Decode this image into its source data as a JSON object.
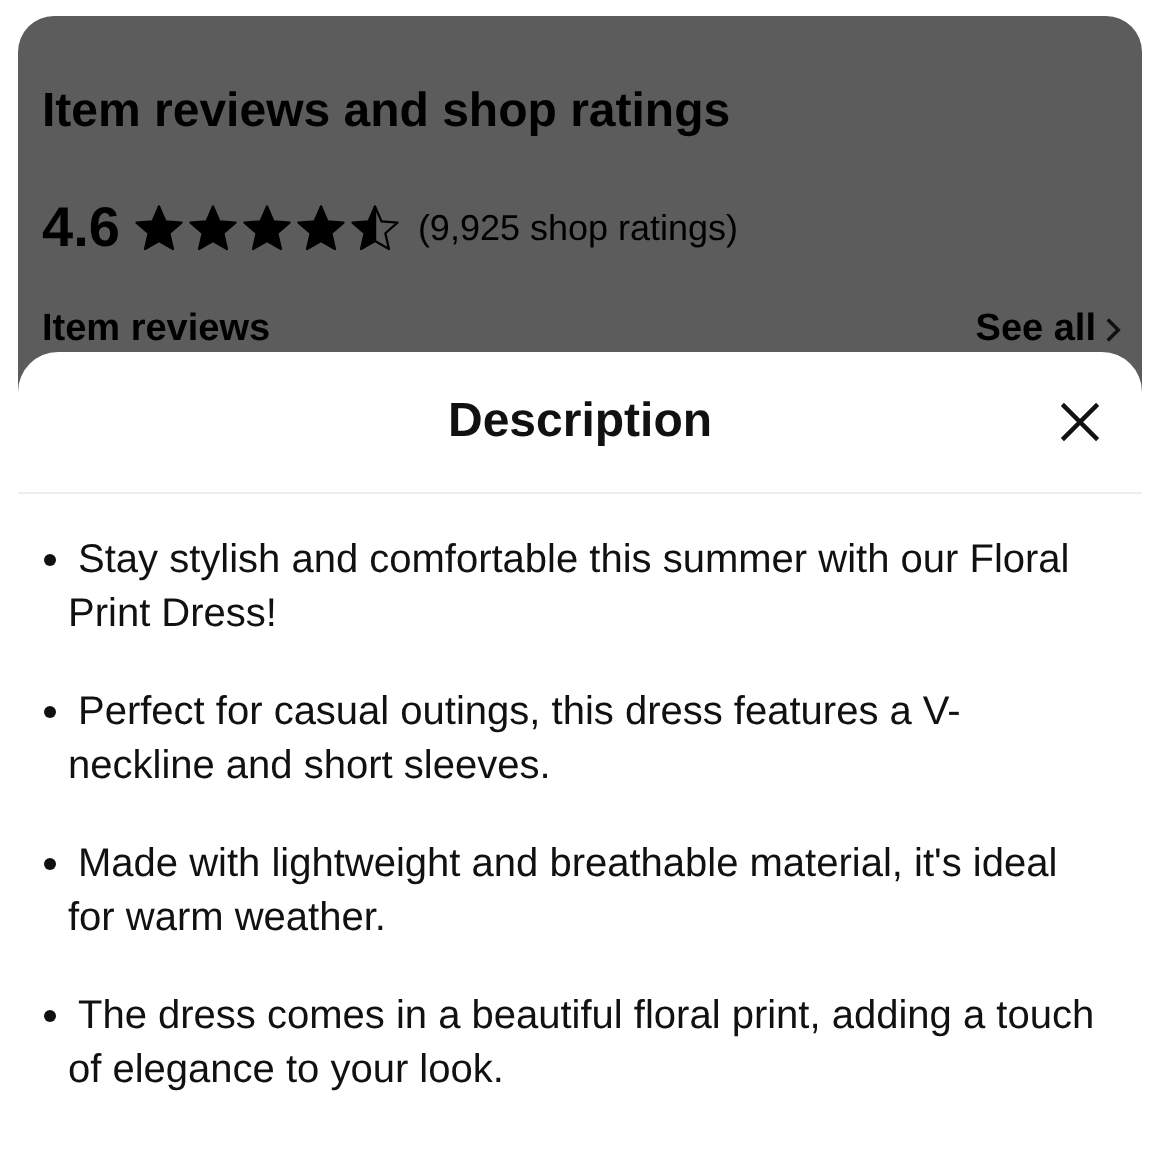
{
  "background_page": {
    "title": "Item reviews and shop ratings",
    "rating": "4.6",
    "stars": 4.5,
    "rating_count": "(9,925 shop ratings)",
    "section_title": "Item reviews",
    "see_all": "See all"
  },
  "sheet": {
    "title": "Description",
    "bullets": [
      "Stay stylish and comfortable this summer with our Floral Print Dress!",
      "Perfect for casual outings, this dress features a V-neckline and short sleeves.",
      "Made with lightweight and breathable material, it's ideal for warm weather.",
      "The dress comes in a beautiful floral print, adding a touch of elegance to your look."
    ]
  }
}
